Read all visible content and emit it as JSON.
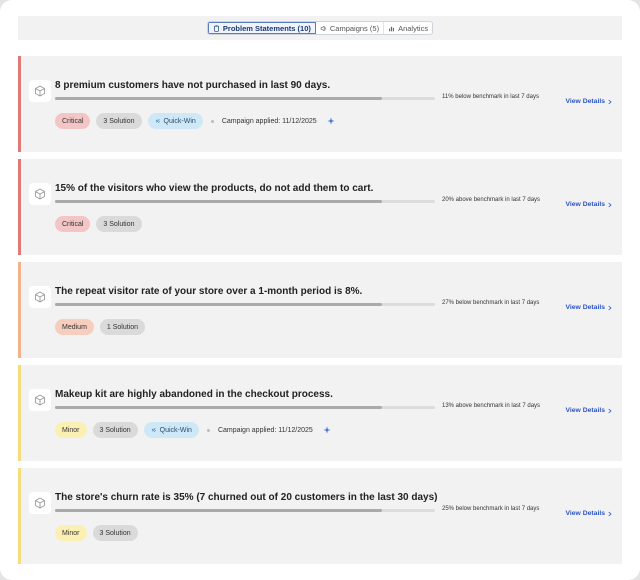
{
  "colors": {
    "critical": "#e07a7a",
    "medium": "#f1b38e",
    "minor": "#f6dc7c",
    "link": "#2b55c6",
    "active_tab": "#1d3a6e"
  },
  "tabs": [
    {
      "label": "Problem Statements (10)",
      "icon": "clipboard-icon",
      "active": true
    },
    {
      "label": "Campaigns (5)",
      "icon": "megaphone-icon",
      "active": false
    },
    {
      "label": "Analytics",
      "icon": "bar-chart-icon",
      "active": false
    }
  ],
  "view_details_label": "View Details",
  "campaign_prefix": "Campaign applied:",
  "cards": [
    {
      "title": "8 premium customers have not purchased in last 90 days.",
      "benchmark": "11% below benchmark in last 7 days",
      "progress": 0.86,
      "severity": "Critical",
      "solutions": "3 Solution",
      "quick_win": "Quick-Win",
      "campaign_date": "11/12/2025"
    },
    {
      "title": "15% of the visitors who view the products, do not add them to cart.",
      "benchmark": "20% above benchmark in last 7 days",
      "progress": 0.86,
      "severity": "Critical",
      "solutions": "3 Solution"
    },
    {
      "title": "The repeat visitor rate of your store over a 1-month period is 8%.",
      "benchmark": "27% below benchmark in last 7 days",
      "progress": 0.86,
      "severity": "Medium",
      "solutions": "1 Solution"
    },
    {
      "title": "Makeup kit are highly abandoned in the checkout process.",
      "benchmark": "13% above benchmark in last 7 days",
      "progress": 0.86,
      "severity": "Minor",
      "solutions": "3 Solution",
      "quick_win": "Quick-Win",
      "campaign_date": "11/12/2025"
    },
    {
      "title": "The store's churn rate is 35% (7 churned out of 20 customers in the last 30 days)",
      "benchmark": "25% below benchmark in last 7 days",
      "progress": 0.86,
      "severity": "Minor",
      "solutions": "3 Solution"
    }
  ]
}
